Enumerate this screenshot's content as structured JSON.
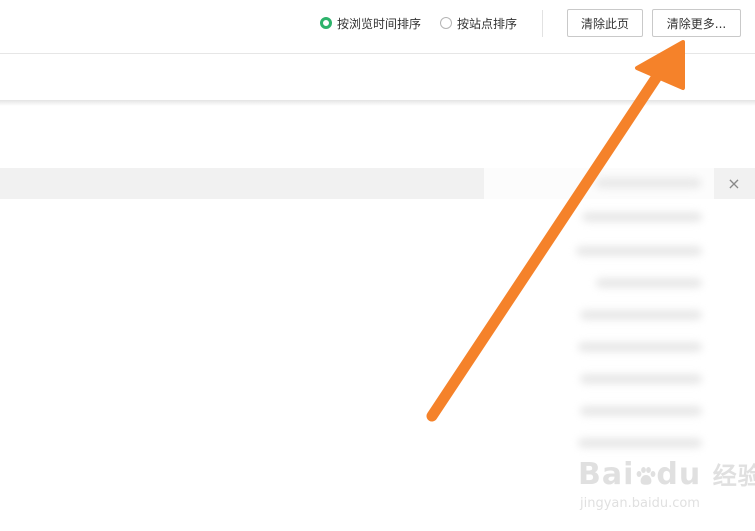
{
  "toolbar": {
    "sort_options": [
      {
        "label": "按浏览时间排序",
        "checked": true
      },
      {
        "label": "按站点排序",
        "checked": false
      }
    ],
    "clear_page_label": "清除此页",
    "clear_more_label": "清除更多..."
  },
  "list": {
    "close_glyph": "×"
  },
  "annotation": {
    "arrow_color": "#f5822a"
  },
  "watermark": {
    "brand_left": "Bai",
    "brand_right": "du",
    "brand_cn": "经验",
    "url": "jingyan.baidu.com"
  },
  "colors": {
    "radio_checked": "#2db36b",
    "row_highlight": "#f1f1f1",
    "arrow": "#f5822a"
  }
}
